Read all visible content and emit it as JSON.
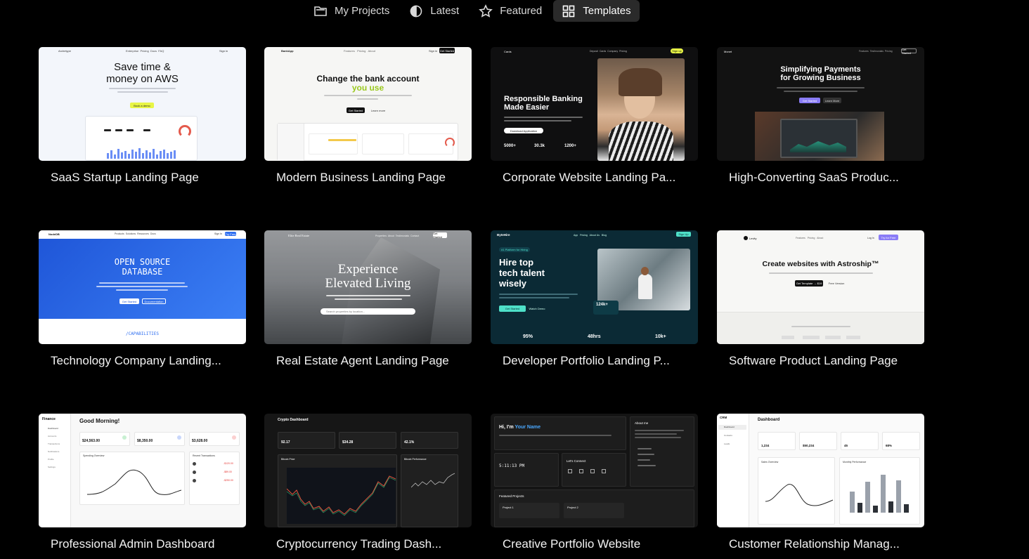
{
  "tabs": [
    {
      "label": "My Projects",
      "icon": "folder-icon"
    },
    {
      "label": "Latest",
      "icon": "half-circle-icon"
    },
    {
      "label": "Featured",
      "icon": "star-icon"
    },
    {
      "label": "Templates",
      "icon": "grid-icon",
      "active": true
    }
  ],
  "cards": [
    {
      "title": "SaaS Startup Landing Page"
    },
    {
      "title": "Modern Business Landing Page"
    },
    {
      "title": "Corporate Website Landing Pa..."
    },
    {
      "title": "High-Converting SaaS Produc..."
    },
    {
      "title": "Technology Company Landing..."
    },
    {
      "title": "Real Estate Agent Landing Page"
    },
    {
      "title": "Developer Portfolio Landing P..."
    },
    {
      "title": "Software Product Landing Page"
    },
    {
      "title": "Professional Admin Dashboard"
    },
    {
      "title": "Cryptocurrency Trading Dash..."
    },
    {
      "title": "Creative Portfolio Website"
    },
    {
      "title": "Customer Relationship Manag..."
    }
  ],
  "thumbs": {
    "saas": {
      "brand": "Archetype",
      "nav": [
        "Enterprise",
        "Pricing",
        "Docs",
        "FAQ"
      ],
      "signin": "Sign in",
      "headline1": "Save time &",
      "headline2": "money on AWS",
      "button": "Book a demo"
    },
    "bank": {
      "brand": "BankApp",
      "nav": [
        "Features",
        "Pricing",
        "About"
      ],
      "signin": "Sign in",
      "cta": "Get Started",
      "headline1": "Change the bank account",
      "headline2": "you use",
      "btn1": "Get Started",
      "btn2": "Learn more"
    },
    "corp": {
      "brand": "Cards",
      "nav": [
        "Deposit",
        "Cards",
        "Company",
        "Pricing"
      ],
      "cta": "Sign up",
      "headline1": "Responsible Banking",
      "headline2": "Made Easier",
      "button": "Download Application",
      "stats": [
        "5000+",
        "30.3k",
        "1200+"
      ]
    },
    "hcsp": {
      "brand": "Monet",
      "nav": [
        "Features",
        "Testimonials",
        "Pricing"
      ],
      "cta": "Get Started",
      "headline1": "Simplifying Payments",
      "headline2": "for Growing Business",
      "btn1": "Get Started",
      "btn2": "Learn More"
    },
    "tech": {
      "brand": "NodeDB",
      "nav": [
        "Products",
        "Solutions",
        "Resources",
        "Docs"
      ],
      "signin": "Sign In",
      "cta": "Try Free",
      "headline1": "OPEN SOURCE",
      "headline2": "DATABASE",
      "btn1": "Get Started",
      "btn2": "Documentation",
      "caps": "/CAPABILITIES"
    },
    "realestate": {
      "brand": "Elite Real Estate",
      "nav": [
        "Properties",
        "About",
        "Testimonials",
        "Contact"
      ],
      "cta": "Get Started",
      "headline1": "Experience",
      "headline2": "Elevated Living",
      "search": "Search properties by location..."
    },
    "dev": {
      "brand": "ByteHire",
      "nav": [
        "App",
        "Pricing",
        "About Us",
        "Blog"
      ],
      "cta": "Sign Up",
      "badge": "#1 Platform for Hiring",
      "headline1": "Hire top",
      "headline2": "tech talent",
      "headline3": "wisely",
      "btn1": "Get Started",
      "btn2": "Watch Demo",
      "float": "124k+",
      "stats": [
        "95%",
        "48hrs",
        "10k+"
      ]
    },
    "software": {
      "brand": "Levity",
      "nav": [
        "Features",
        "Pricing",
        "About"
      ],
      "login": "Log In",
      "cta": "Try for Free",
      "headline": "Create websites with Astroship™",
      "btn1": "Get Template → $19",
      "btn2": "Free Version"
    },
    "admin": {
      "brand": "Finance",
      "greeting": "Good Morning!",
      "side": [
        "Dashboard",
        "Accounts",
        "Transactions",
        "Notifications",
        "Profile",
        "Settings"
      ],
      "stats": [
        "$24,563.00",
        "$8,350.00",
        "$3,628.00"
      ],
      "chart": "Spending Overview",
      "recent": "Recent Transactions",
      "rows": [
        "-$120.00",
        "-$89.00",
        "-$250.00"
      ]
    },
    "crypto": {
      "title": "Crypto Dashboard",
      "stats": [
        "92.17",
        "$34.28",
        "42.1%"
      ],
      "chart1": "Bitcoin Price",
      "chart2": "Bitcoin Performance"
    },
    "portfolio": {
      "hello": "Hi, I'm ",
      "name": "Your Name",
      "about": "About me",
      "time": "5:11:13 PM",
      "connect": "Let's Connect",
      "featured": "Featured Projects",
      "p1": "Project 1",
      "p2": "Project 2"
    },
    "crm": {
      "brand": "CRM",
      "title": "Dashboard",
      "side": [
        "Dashboard",
        "Contacts",
        "Leads"
      ],
      "stats": [
        "1,234",
        "$50,234",
        "45",
        "68%"
      ],
      "chart1": "Sales Overview",
      "chart2": "Monthly Performance"
    }
  },
  "colors": {
    "accent_yellow": "#e8f545",
    "accent_green": "#9ac81e",
    "db_blue": "#2f6ff0",
    "teal": "#4ee0c8",
    "purple": "#8a7cf6"
  }
}
